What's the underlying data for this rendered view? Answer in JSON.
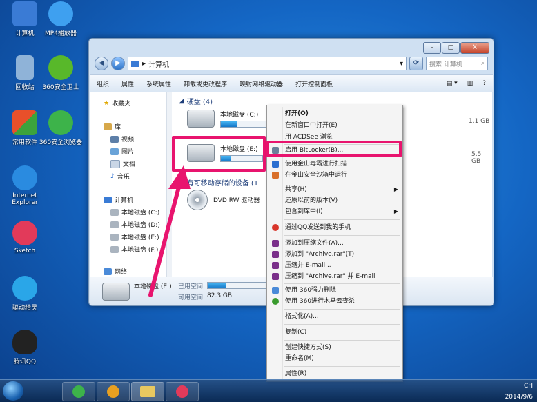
{
  "desktop_icons": [
    {
      "label": "计算机",
      "color": "#3a7bd5"
    },
    {
      "label": "MP4播放器",
      "color": "#3ea0f0"
    },
    {
      "label": "回收站",
      "color": "#8fb3d8"
    },
    {
      "label": "360安全卫士",
      "color": "#58b82a"
    },
    {
      "label": "常用软件",
      "color": "#e8a020"
    },
    {
      "label": "360安全浏览器",
      "color": "#3db34a"
    },
    {
      "label": "Internet Explorer",
      "color": "#2a8be0"
    },
    {
      "label": "Sketch",
      "color": "#e23a5a"
    },
    {
      "label": "驱动精灵",
      "color": "#2aa6e8"
    },
    {
      "label": "腾讯QQ",
      "color": "#222222"
    }
  ],
  "window": {
    "address": "计算机",
    "search_placeholder": "搜索 计算机",
    "controls": {
      "minimize": "–",
      "maximize": "□",
      "close": "X"
    }
  },
  "toolbar": [
    "组织",
    "属性",
    "系统属性",
    "卸载或更改程序",
    "映射网络驱动器",
    "打开控制面板"
  ],
  "nav_pane": {
    "favorites": "收藏夹",
    "libraries": "库",
    "lib_items": [
      "视频",
      "图片",
      "文档",
      "音乐"
    ],
    "computer": "计算机",
    "drives": [
      "本地磁盘 (C:)",
      "本地磁盘 (D:)",
      "本地磁盘 (E:)",
      "本地磁盘 (F:)"
    ],
    "network": "网络"
  },
  "content": {
    "hdd_header": "硬盘 (4)",
    "drive_c": {
      "name": "本地磁盘 (C:)",
      "fill": 0.15,
      "size": "1.1 GB"
    },
    "drive_e": {
      "name": "本地磁盘 (E:)",
      "fill": 0.25,
      "size": "5.5 GB"
    },
    "removable_header": "有可移动存储的设备 (1",
    "dvd": "DVD RW 驱动器"
  },
  "status": {
    "name": "本地磁盘 (E:)",
    "used_label": "已用空间:",
    "free_label": "可用空间:",
    "free_value": "82.3 GB",
    "fill": 0.3
  },
  "menu_items": [
    {
      "label": "打开(O)",
      "icon": null,
      "bold": true
    },
    {
      "label": "在新窗口中打开(E)",
      "icon": null
    },
    {
      "label": "用 ACDSee 浏览",
      "icon": null
    },
    {
      "label": "启用 BitLocker(B)...",
      "icon": "#6a7f99"
    },
    {
      "label": "使用金山毒霸进行扫描",
      "icon": "#2b6fd0"
    },
    {
      "label": "在金山安全沙箱中运行",
      "icon": "#d9702a"
    },
    {
      "label": "共享(H)",
      "icon": null,
      "sub": true
    },
    {
      "label": "还原以前的版本(V)",
      "icon": null
    },
    {
      "label": "包含到库中(I)",
      "icon": null,
      "sub": true
    },
    {
      "label": "通过QQ发送到我的手机",
      "icon": "#d8352a"
    },
    {
      "label": "添加到压缩文件(A)...",
      "icon": "#7a2f8a"
    },
    {
      "label": "添加到 \"Archive.rar\"(T)",
      "icon": "#7a2f8a"
    },
    {
      "label": "压缩并 E-mail...",
      "icon": "#7a2f8a"
    },
    {
      "label": "压缩到 \"Archive.rar\" 并 E-mail",
      "icon": "#7a2f8a"
    },
    {
      "label": "使用 360强力删除",
      "icon": "#4a8ad8"
    },
    {
      "label": "使用 360进行木马云查杀",
      "icon": "#3a9b2e"
    },
    {
      "label": "格式化(A)...",
      "icon": null
    },
    {
      "label": "复制(C)",
      "icon": null
    },
    {
      "label": "创建快捷方式(S)",
      "icon": null
    },
    {
      "label": "重命名(M)",
      "icon": null
    },
    {
      "label": "属性(R)",
      "icon": null
    }
  ],
  "taskbar": {
    "tray_text": "CH",
    "time": "2014/9/6"
  },
  "colors": {
    "highlight": "#e8146e"
  }
}
